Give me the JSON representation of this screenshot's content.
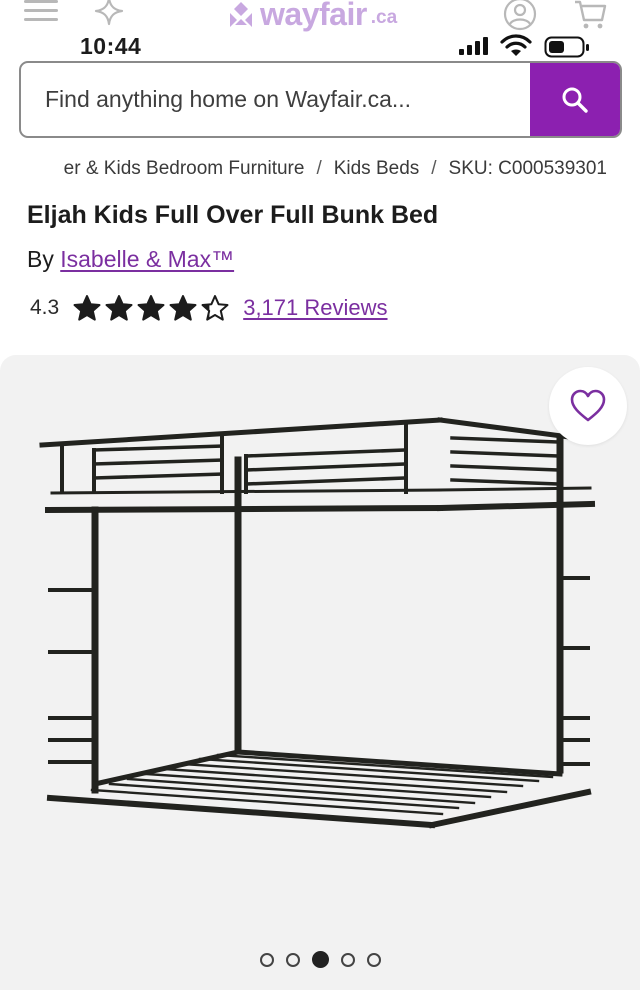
{
  "header": {
    "logo_text": "wayfair",
    "logo_suffix": ".ca",
    "icons": [
      "menu-icon",
      "sparkle-icon",
      "account-icon",
      "cart-icon"
    ]
  },
  "status_bar": {
    "time": "10:44",
    "icons": [
      "signal-icon",
      "wifi-icon",
      "battery-icon"
    ]
  },
  "search": {
    "placeholder": "Find anything home on Wayfair.ca...",
    "value": "",
    "button_icon": "search-icon"
  },
  "breadcrumb": {
    "items": [
      "er & Kids Bedroom Furniture",
      "Kids Beds",
      "SKU: C000539301"
    ],
    "separator": "/"
  },
  "product": {
    "title": "Eljah Kids Full Over Full Bunk Bed",
    "by_label": "By",
    "brand": "Isabelle & Max™",
    "rating": "4.3",
    "rating_value": 4.3,
    "rating_max": 5,
    "reviews_text": "3,171 Reviews"
  },
  "gallery": {
    "image_name": "bunk-bed-image",
    "favorite_icon": "heart-icon",
    "total_images": 5,
    "active_index": 2
  },
  "colors": {
    "brand_purple": "#8c20b0",
    "link_purple": "#7b2fa0",
    "logo_lavender": "#c8a8e0",
    "gallery_bg": "#f2f2f2",
    "frame_black": "#22231f"
  }
}
